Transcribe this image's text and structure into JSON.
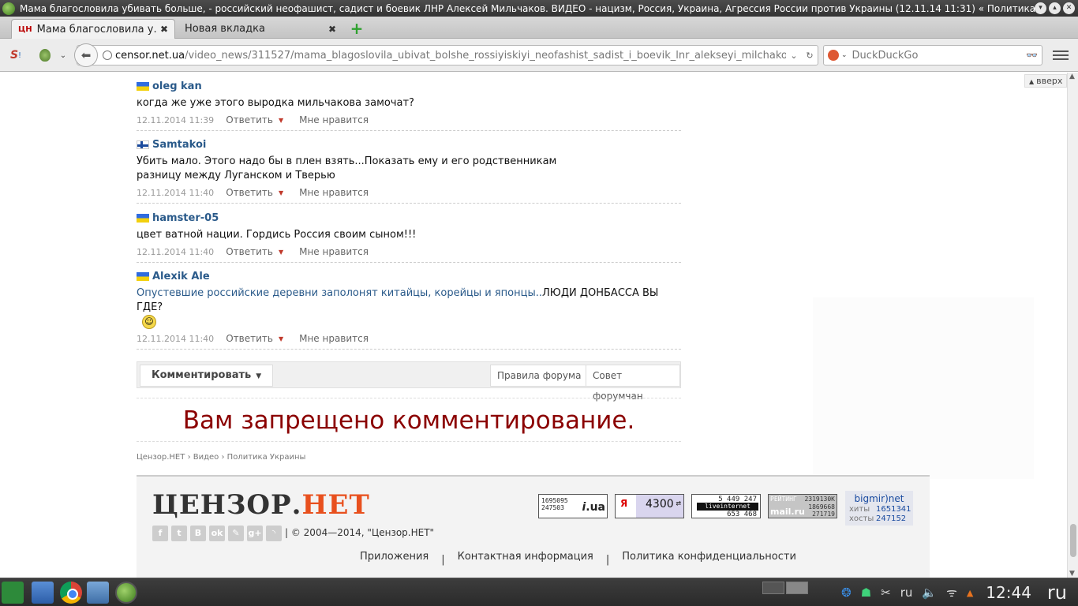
{
  "window": {
    "title": "Мама благословила убивать больше, - российский неофашист, садист и боевик ЛНР Алексей Мильчаков. ВИДЕО - нацизм, Россия, Украина, Агрессия России против Украины (12.11.14 11:31) « Политика Украины ..."
  },
  "tabs": [
    {
      "label": "Мама благословила у...",
      "favicon": "ЦН"
    },
    {
      "label": "Новая вкладка"
    }
  ],
  "nav": {
    "url_host": "censor.net.ua",
    "url_path": "/video_news/311527/mama_blagoslovila_ubivat_bolshe_rossiyiskiyi_neofashist_sadist_i_boevik_lnr_alekseyi_milchakov_video",
    "search_placeholder": "DuckDuckGo"
  },
  "page": {
    "up_label": "вверх",
    "comments": [
      {
        "flag": "ua",
        "author": "oleg kan",
        "text": "когда же уже этого выродка мильчакова замочат?",
        "date": "12.11.2014 11:39",
        "reply": "Ответить",
        "like": "Мне нравится"
      },
      {
        "flag": "fi",
        "author": "Samtakoi",
        "text_line1": "Убить мало. Этого надо бы в плен взять...Показать ему и его родственникам",
        "text_line2": "разницу между Луганском и Тверью",
        "date": "12.11.2014 11:40",
        "reply": "Ответить",
        "like": "Мне нравится"
      },
      {
        "flag": "ua",
        "author": "hamster-05",
        "text": "цвет ватной нации. Гордись Россия своим сыном!!!",
        "date": "12.11.2014 11:40",
        "reply": "Ответить",
        "like": "Мне нравится"
      },
      {
        "flag": "ua",
        "author": "Alexik Ale",
        "text_link": "Опустевшие российские деревни заполонят китайцы, корейцы и японцы..",
        "text_rest": "ЛЮДИ ДОНБАССА ВЫ ГДЕ?",
        "date": "12.11.2014 11:40",
        "reply": "Ответить",
        "like": "Мне нравится"
      }
    ],
    "toolbar": {
      "comment": "Комментировать",
      "rules": "Правила форума",
      "advice": "Совет форумчан"
    },
    "banned_message": "Вам запрещено комментирование.",
    "breadcrumb": [
      "Цензор.НЕТ",
      "Видео",
      "Политика Украины"
    ],
    "breadcrumb_sep": "›"
  },
  "footer": {
    "logo_part1": "ЦЕНЗОР.",
    "logo_part2": "НЕТ",
    "copyright": "| © 2004—2014,  \"Цензор.НЕТ\"",
    "counters": {
      "iua_1": "1695095",
      "iua_2": "247503",
      "iua_brand": ".ua",
      "ya_label": "Я",
      "ya_value": "4300",
      "li_1": "5 449 247",
      "li_brand": "liveinternet",
      "li_2": "653 468",
      "mail_label": "РЕЙТИНГ",
      "mail_1": "2319130K",
      "mail_2": "1869668",
      "mail_3": "271719",
      "mail_brand": "mail.ru"
    },
    "bigmir": {
      "title": "bigmir)net",
      "hits_label": "хиты",
      "hits": "1651341",
      "hosts_label": "хосты",
      "hosts": "247152"
    },
    "links": [
      "Приложения",
      "Контактная информация",
      "Политика конфиденциальности"
    ],
    "link_sep": "|"
  },
  "taskbar": {
    "clock": "12:44",
    "keyboard_layout": "ru",
    "lang": "ru"
  }
}
